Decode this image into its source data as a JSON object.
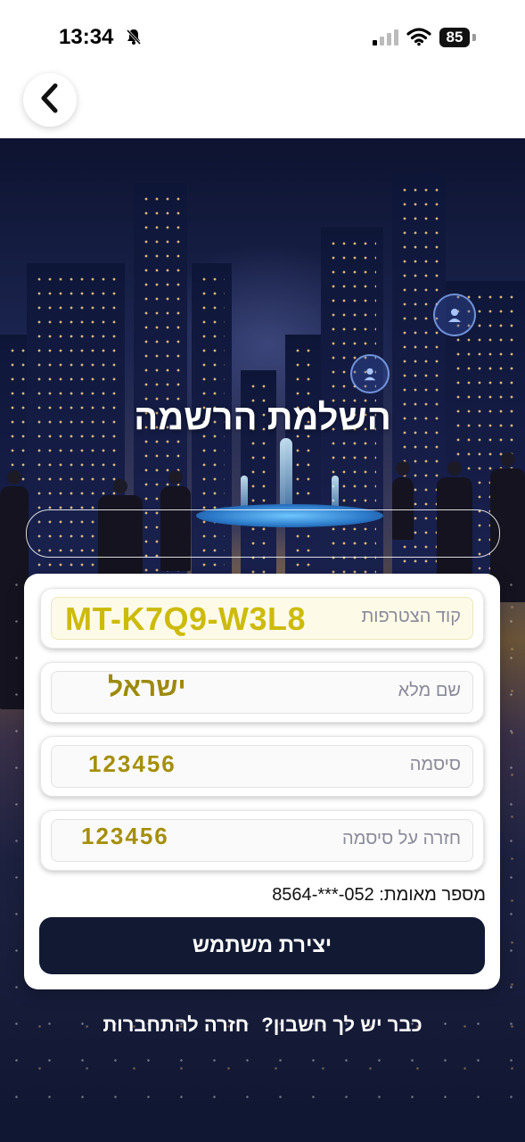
{
  "status_bar": {
    "time": "13:34",
    "battery": "85",
    "icons": [
      "bell-slash-icon",
      "signal-icon",
      "wifi-icon",
      "battery-icon"
    ]
  },
  "header": {
    "back_icon": "chevron-left-icon"
  },
  "page": {
    "title": "השלמת הרשמה"
  },
  "form": {
    "invite_code": {
      "label": "קוד הצטרפות",
      "value": "MT-K7Q9-W3L8"
    },
    "full_name": {
      "label": "שם מלא",
      "value": "ישראל"
    },
    "password": {
      "label": "סיסמה",
      "value": "123456"
    },
    "confirm_password": {
      "label": "חזרה על סיסמה",
      "value": "123456"
    },
    "verified_number": "מספר מאומת: 052-***-8564",
    "submit_label": "יצירת משתמש"
  },
  "footer": {
    "prompt": "כבר יש לך חשבון?",
    "link": "חזרה להתחברות"
  },
  "colors": {
    "accent_dark": "#121a33",
    "field_value": "#b9a40a",
    "card": "#ffffff"
  }
}
